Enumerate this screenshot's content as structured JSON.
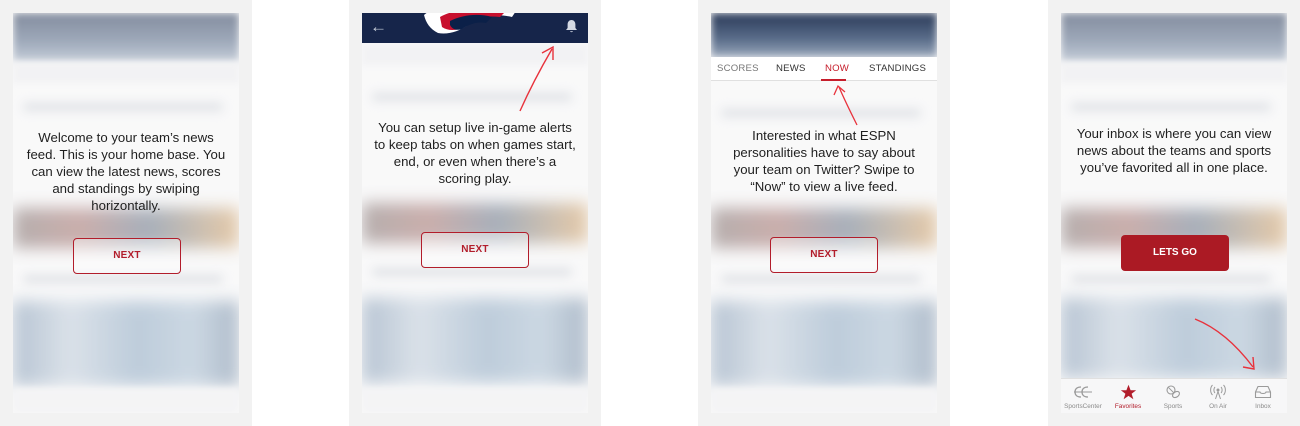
{
  "screens": [
    {
      "message": "Welcome to your team’s news feed. This is your home base. You can view the latest news, scores and standings by swiping horizontally.",
      "button": "NEXT"
    },
    {
      "message": "You can setup live in-game alerts to keep tabs on when games start, end, or even when there’s a scoring play.",
      "button": "NEXT"
    },
    {
      "message": "Interested in what ESPN personalities have to say about your team on Twitter? Swipe to “Now” to view a live feed.",
      "button": "NEXT",
      "tabs": [
        "SCORES",
        "NEWS",
        "NOW",
        "STANDINGS"
      ],
      "active_tab": "NOW"
    },
    {
      "message": "Your inbox is where you can view news about the teams and sports you’ve favorited all in one place.",
      "button": "LETS GO",
      "tabbar": [
        "SportsCenter",
        "Favorites",
        "Sports",
        "On Air",
        "Inbox"
      ],
      "active_tab": "Favorites"
    }
  ],
  "colors": {
    "accent": "#b21d2b",
    "button_fill": "#ab1a24",
    "header_navy": "#16254a",
    "annotation_arrow": "#e8323c"
  },
  "icons": [
    "back-arrow-icon",
    "bell-icon",
    "team-logo",
    "sportscenter-icon",
    "star-icon",
    "sports-icon",
    "on-air-icon",
    "inbox-icon"
  ]
}
